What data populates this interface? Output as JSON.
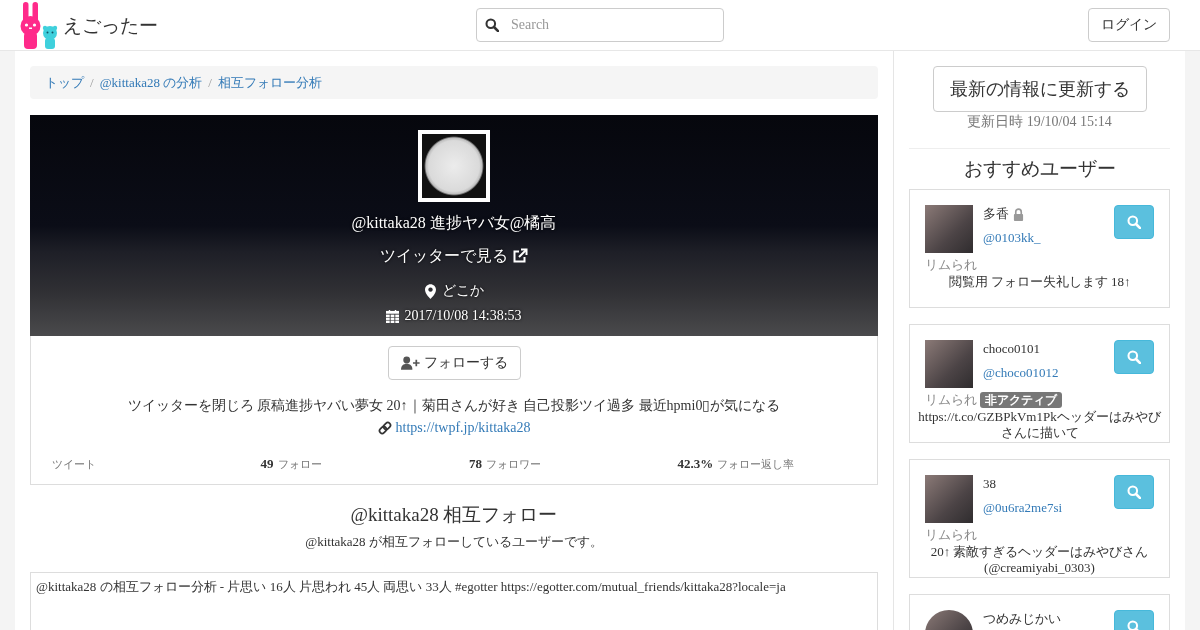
{
  "navbar": {
    "brand": "えごったー",
    "search": {
      "placeholder": "Search"
    },
    "login_button": "ログイン"
  },
  "breadcrumb": {
    "separator": "/",
    "items": [
      {
        "label": "トップ"
      },
      {
        "label": "@kittaka28 の分析"
      },
      {
        "label": "相互フォロー分析"
      }
    ]
  },
  "profile": {
    "name": "@kittaka28 進捗ヤバ女@橘高",
    "twitter_link": "ツイッターで見る",
    "location": "どこか",
    "created_at": "2017/10/08 14:38:53",
    "follow_button": "フォローする",
    "bio": "ツイッターを閉じろ 原稿進捗ヤバい夢女 20↑｜菊田さんが好き 自己投影ツイ過多 最近hpmi0▯が気になる",
    "url": "https://twpf.jp/kittaka28",
    "stats": [
      {
        "label": "ツイート"
      },
      {
        "value": "49",
        "label": "フォロー"
      },
      {
        "value": "78",
        "label": "フォロワー"
      },
      {
        "value": "42.3%",
        "label": "フォロー返し率"
      }
    ]
  },
  "mutual": {
    "title": "@kittaka28 相互フォロー",
    "subtitle": "@kittaka28 が相互フォローしているユーザーです。",
    "share_text": "@kittaka28 の相互フォロー分析 - 片思い 16人 片思われ 45人 両思い 33人 #egotter https://egotter.com/mutual_friends/kittaka28?locale=ja"
  },
  "sidebar": {
    "refresh_button": "最新の情報に更新する",
    "updated_at": "更新日時 19/10/04 15:14",
    "recommended_title": "おすすめユーザー",
    "users": [
      {
        "kind": "square",
        "name": "多香",
        "protected": true,
        "handle": "@0103kk_",
        "status": "リムられ",
        "description": "閲覧用 フォロー失礼します 18↑"
      },
      {
        "kind": "square",
        "name": "choco0101",
        "protected": false,
        "handle": "@choco01012",
        "status": "リムられ",
        "badge": "非アクティブ",
        "description": "https://t.co/GZBPkVm1Pkヘッダーはみやびさんに描いて"
      },
      {
        "kind": "square",
        "name": "38",
        "protected": false,
        "handle": "@0u6ra2me7si",
        "status": "リムられ",
        "description": "20↑ 素敵すぎるヘッダーはみやびさん(@creamiyabi_0303)"
      },
      {
        "kind": "round",
        "name": "つめみじかい",
        "protected": false
      }
    ]
  }
}
